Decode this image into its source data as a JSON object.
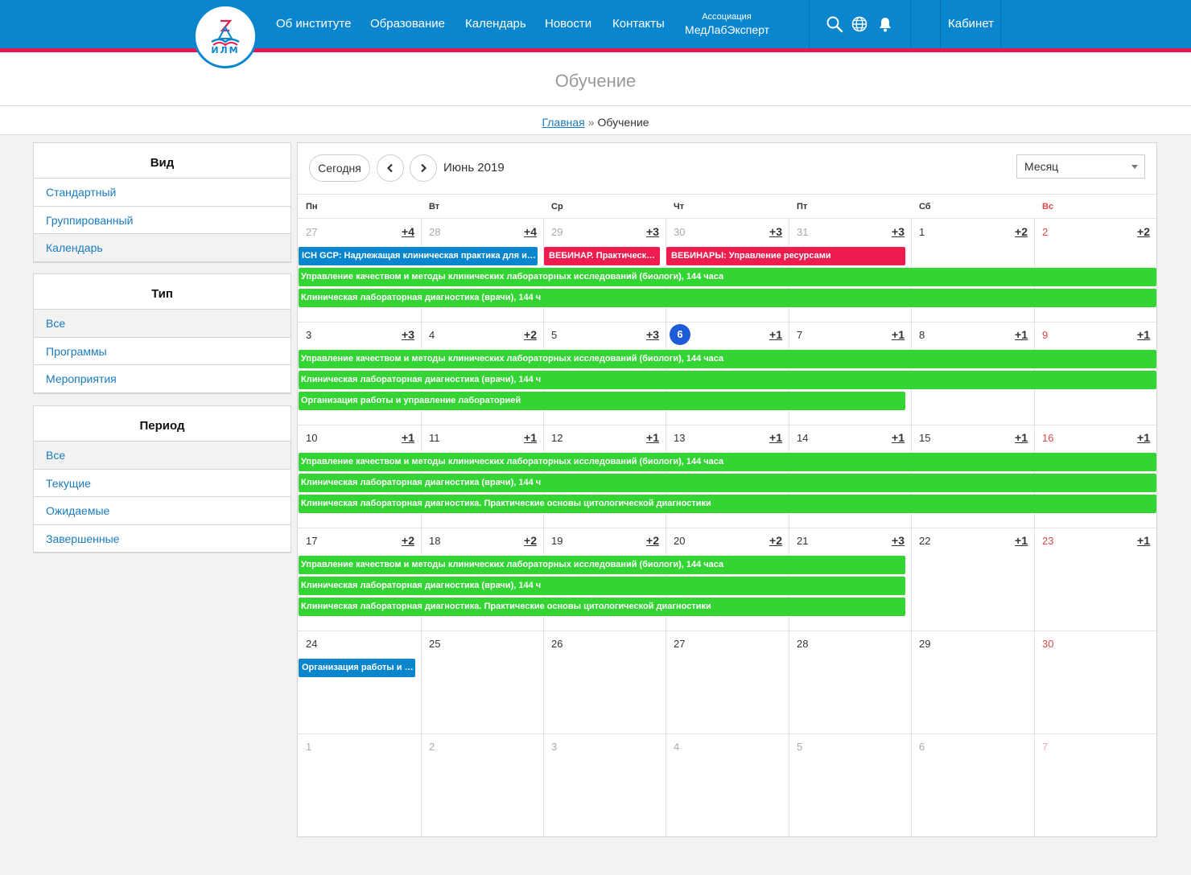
{
  "header": {
    "logo_text": "ИЛМ",
    "nav": [
      "Об институте",
      "Образование",
      "Календарь",
      "Новости",
      "Контакты"
    ],
    "association_line1": "Ассоциация",
    "association_line2": "МедЛабЭксперт",
    "cabinet": "Кабинет"
  },
  "page": {
    "title": "Обучение",
    "breadcrumb_home": "Главная",
    "breadcrumb_sep": "»",
    "breadcrumb_current": "Обучение"
  },
  "sidebar": {
    "view": {
      "title": "Вид",
      "items": [
        "Стандартный",
        "Группированный",
        "Календарь"
      ],
      "active": 2
    },
    "type": {
      "title": "Тип",
      "items": [
        "Все",
        "Программы",
        "Мероприятия"
      ],
      "active": 0
    },
    "period": {
      "title": "Период",
      "items": [
        "Все",
        "Текущие",
        "Ожидаемые",
        "Завершенные"
      ],
      "active": 0
    }
  },
  "calendar": {
    "today_button": "Сегодня",
    "prev_icon": "chevron-left-icon",
    "next_icon": "chevron-right-icon",
    "month_title": "Июнь 2019",
    "view_select": "Месяц",
    "weekdays": [
      "Пн",
      "Вт",
      "Ср",
      "Чт",
      "Пт",
      "Сб",
      "Вс"
    ],
    "weeks": [
      {
        "days": [
          {
            "n": "27",
            "muted": true,
            "more": "+4"
          },
          {
            "n": "28",
            "muted": true,
            "more": "+4"
          },
          {
            "n": "29",
            "muted": true,
            "more": "+3"
          },
          {
            "n": "30",
            "muted": true,
            "more": "+3"
          },
          {
            "n": "31",
            "muted": true,
            "more": "+3"
          },
          {
            "n": "1",
            "more": "+2"
          },
          {
            "n": "2",
            "more": "+2"
          }
        ],
        "events": [
          {
            "title": "ICH GCP: Надлежащая клиническая практика для исследователей",
            "color": "blue",
            "start": 0,
            "span": 2,
            "row": 0
          },
          {
            "title": "ВЕБИНАР. Практические аспекты",
            "color": "red",
            "start": 2,
            "span": 1,
            "row": 0
          },
          {
            "title": "ВЕБИНАРЫ: Управление ресурсами",
            "color": "red",
            "start": 3,
            "span": 2,
            "row": 0
          },
          {
            "title": "Управление качеством и методы клинических лабораторных исследований (биологи), 144 часа",
            "color": "green",
            "start": 0,
            "span": 7,
            "row": 1
          },
          {
            "title": "Клиническая лабораторная диагностика (врачи), 144 ч",
            "color": "green",
            "start": 0,
            "span": 7,
            "row": 2
          }
        ]
      },
      {
        "days": [
          {
            "n": "3",
            "more": "+3"
          },
          {
            "n": "4",
            "more": "+2"
          },
          {
            "n": "5",
            "more": "+3"
          },
          {
            "n": "6",
            "today": true,
            "more": "+1"
          },
          {
            "n": "7",
            "more": "+1"
          },
          {
            "n": "8",
            "more": "+1"
          },
          {
            "n": "9",
            "more": "+1"
          }
        ],
        "events": [
          {
            "title": "Управление качеством и методы клинических лабораторных исследований (биологи), 144 часа",
            "color": "green",
            "start": 0,
            "span": 7,
            "row": 0
          },
          {
            "title": "Клиническая лабораторная диагностика (врачи), 144 ч",
            "color": "green",
            "start": 0,
            "span": 7,
            "row": 1
          },
          {
            "title": "Организация работы и управление лабораторией",
            "color": "green",
            "start": 0,
            "span": 5,
            "row": 2
          }
        ]
      },
      {
        "days": [
          {
            "n": "10",
            "more": "+1"
          },
          {
            "n": "11",
            "more": "+1"
          },
          {
            "n": "12",
            "more": "+1"
          },
          {
            "n": "13",
            "more": "+1"
          },
          {
            "n": "14",
            "more": "+1"
          },
          {
            "n": "15",
            "more": "+1"
          },
          {
            "n": "16",
            "more": "+1"
          }
        ],
        "events": [
          {
            "title": "Управление качеством и методы клинических лабораторных исследований (биологи), 144 часа",
            "color": "green",
            "start": 0,
            "span": 7,
            "row": 0
          },
          {
            "title": "Клиническая лабораторная диагностика (врачи), 144 ч",
            "color": "green",
            "start": 0,
            "span": 7,
            "row": 1
          },
          {
            "title": "Клиническая лабораторная диагностика. Практические основы цитологической диагностики",
            "color": "green",
            "start": 0,
            "span": 7,
            "row": 2
          }
        ]
      },
      {
        "days": [
          {
            "n": "17",
            "more": "+2"
          },
          {
            "n": "18",
            "more": "+2"
          },
          {
            "n": "19",
            "more": "+2"
          },
          {
            "n": "20",
            "more": "+2"
          },
          {
            "n": "21",
            "more": "+3"
          },
          {
            "n": "22",
            "more": "+1"
          },
          {
            "n": "23",
            "more": "+1"
          }
        ],
        "events": [
          {
            "title": "Управление качеством и методы клинических лабораторных исследований (биологи), 144 часа",
            "color": "green",
            "start": 0,
            "span": 5,
            "row": 0
          },
          {
            "title": "Клиническая лабораторная диагностика (врачи), 144 ч",
            "color": "green",
            "start": 0,
            "span": 5,
            "row": 1
          },
          {
            "title": "Клиническая лабораторная диагностика. Практические основы цитологической диагностики",
            "color": "green",
            "start": 0,
            "span": 5,
            "row": 2
          }
        ]
      },
      {
        "days": [
          {
            "n": "24"
          },
          {
            "n": "25"
          },
          {
            "n": "26"
          },
          {
            "n": "27"
          },
          {
            "n": "28"
          },
          {
            "n": "29"
          },
          {
            "n": "30"
          }
        ],
        "events": [
          {
            "title": "Организация работы и управление лабораторией",
            "color": "blue",
            "start": 0,
            "span": 1,
            "row": 0
          }
        ]
      },
      {
        "days": [
          {
            "n": "1",
            "muted": true
          },
          {
            "n": "2",
            "muted": true
          },
          {
            "n": "3",
            "muted": true
          },
          {
            "n": "4",
            "muted": true
          },
          {
            "n": "5",
            "muted": true
          },
          {
            "n": "6",
            "muted": true
          },
          {
            "n": "7",
            "muted": true
          }
        ],
        "events": []
      }
    ]
  }
}
